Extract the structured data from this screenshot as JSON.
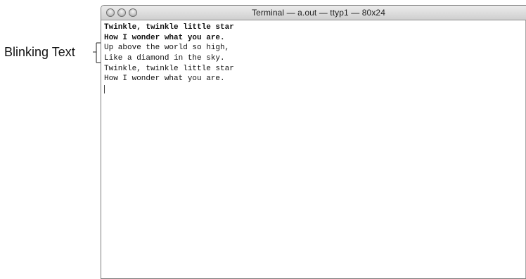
{
  "annotation": {
    "label": "Blinking Text"
  },
  "window": {
    "title": "Terminal — a.out — ttyp1 — 80x24"
  },
  "terminal": {
    "lines": [
      {
        "text": "Twinkle, twinkle little star",
        "bold": true
      },
      {
        "text": "How I wonder what you are.",
        "bold": true
      },
      {
        "text": "Up above the world so high,",
        "bold": false
      },
      {
        "text": "Like a diamond in the sky.",
        "bold": false
      },
      {
        "text": "Twinkle, twinkle little star",
        "bold": false
      },
      {
        "text": "How I wonder what you are.",
        "bold": false
      }
    ]
  },
  "icons": {
    "close": "close-button",
    "minimize": "minimize-button",
    "zoom": "zoom-button"
  }
}
